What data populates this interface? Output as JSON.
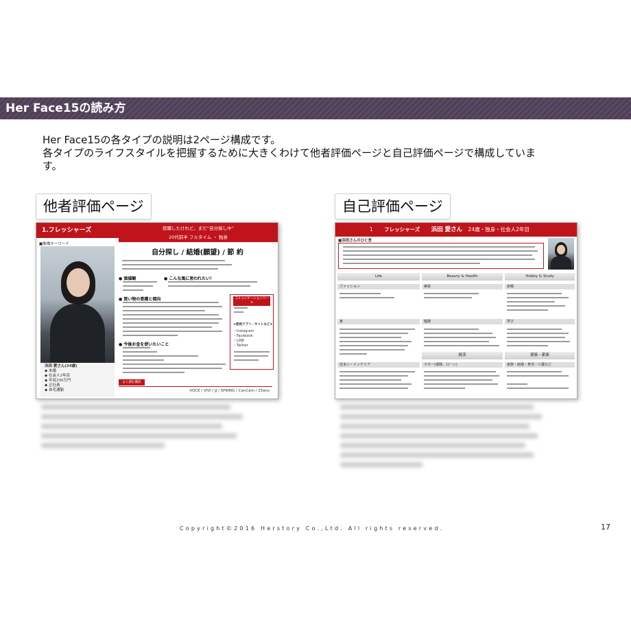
{
  "header": {
    "title": "Her Face15の読み方"
  },
  "intro": {
    "line1": "Her Face15の各タイプの説明は2ページ構成です。",
    "line2": "各タイプのライフスタイルを把握するために大きくわけて他者評価ページと自己評価ページで構成していま",
    "line3": "す。"
  },
  "left_panel": {
    "label": "他者評価ページ",
    "type_title": "1.フレッシャーズ",
    "catch1": "就職したけれど、まだ“自分探し中”",
    "catch2": "20代前半 フルタイム ・ 独身",
    "keyword_label": "■象徴キーワード",
    "keyword": "自分探し / 結婚(願望) / 節 約",
    "bullet1": "● 価値観",
    "bullet2": "● こんな風に思われたい！",
    "bullet3": "● 買い物の意識と傾向",
    "bullet4": "● 今後お金を使いたいこと",
    "comm_label": "コミュニケーションツール",
    "app_label": "★使用アプリ・サイトなど★",
    "apps": [
      "・Instagram",
      "・Facebook",
      "・LINE",
      "・Twitter"
    ],
    "person_name": "浜田 愛さん(24歳)",
    "person_attrs": [
      "◆ 未婚",
      "◆ 社会人2年目",
      "◆ 年収230万円",
      "◆ 正社員",
      "◆ 自宅通勤"
    ],
    "magazine_label": "よく読む雑誌",
    "magazines": "VOCE / VIVI / JJ / SPRING / CanCam / 25ans"
  },
  "right_panel": {
    "label": "自己評価ページ",
    "head_num": "1",
    "head_type": "フレッシャーズ",
    "head_name": "浜田 愛さん",
    "head_attrs": "24歳・独身・社会人2年目",
    "subhead": "■浜田さんのひと言",
    "categories": [
      "Life",
      "Beauty & Health",
      "Hobby & Study"
    ],
    "subcats": [
      "ファッション",
      "美容",
      "余暇",
      "食",
      "健康",
      "学び",
      "住まい・インテリア",
      "マネー(保険、ローン)",
      "家族・結婚・育児・介護など"
    ],
    "econ_label": "経済",
    "family_label": "家族・家族"
  },
  "footer": {
    "copyright": "Copyright©2016 Herstory Co.,Ltd. All rights reserved.",
    "page": "17"
  }
}
